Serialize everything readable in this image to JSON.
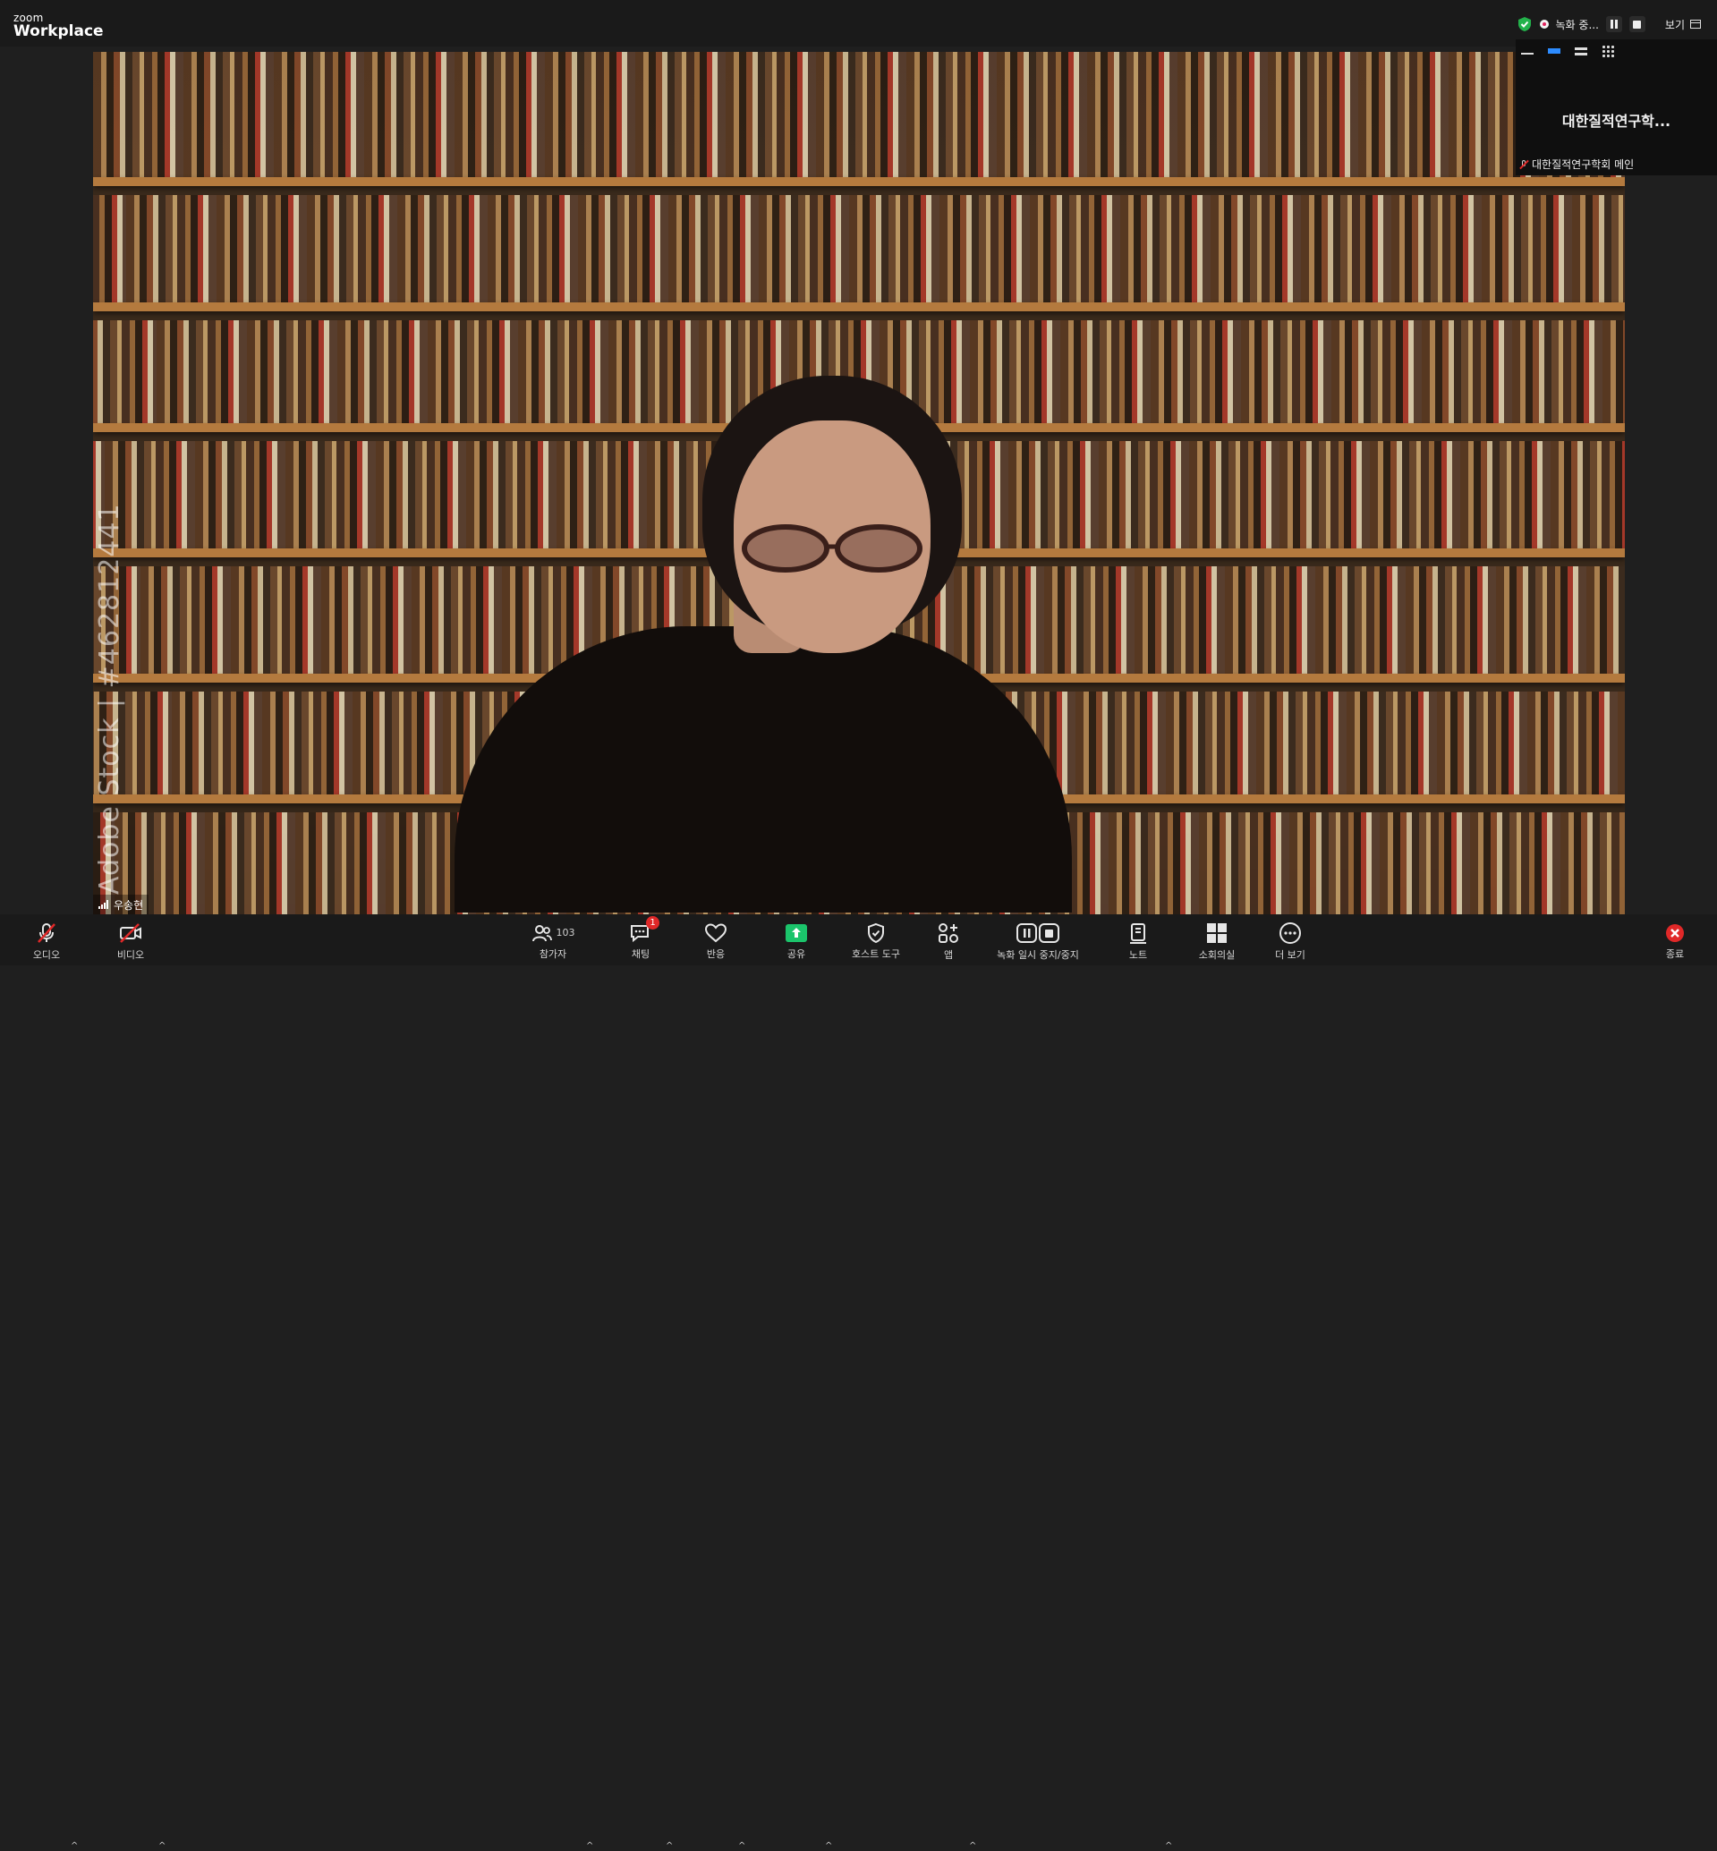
{
  "app": {
    "brand_line1": "zoom",
    "brand_line2": "Workplace"
  },
  "topbar": {
    "recording_status": "녹화 중...",
    "view_label": "보기"
  },
  "main_video": {
    "participant_name": "우송현",
    "watermark_text": "Adobe Stock | #462812441"
  },
  "thumbnail": {
    "display_name": "대한질적연구학...",
    "tag_name": "대한질적연구학회 메인"
  },
  "toolbar": {
    "audio": "오디오",
    "video": "비디오",
    "participants": "참가자",
    "participants_count": "103",
    "chat": "채팅",
    "chat_badge": "1",
    "reactions": "반응",
    "share": "공유",
    "host_tools": "호스트 도구",
    "apps": "앱",
    "recording": "녹화 일시 중지/중지",
    "notes": "노트",
    "breakout": "소회의실",
    "more": "더 보기",
    "end": "종료"
  },
  "colors": {
    "accent_blue": "#2d8cff",
    "share_green": "#1bc46b",
    "danger_red": "#e02828",
    "toolbar_bg": "#1a1a1a"
  }
}
